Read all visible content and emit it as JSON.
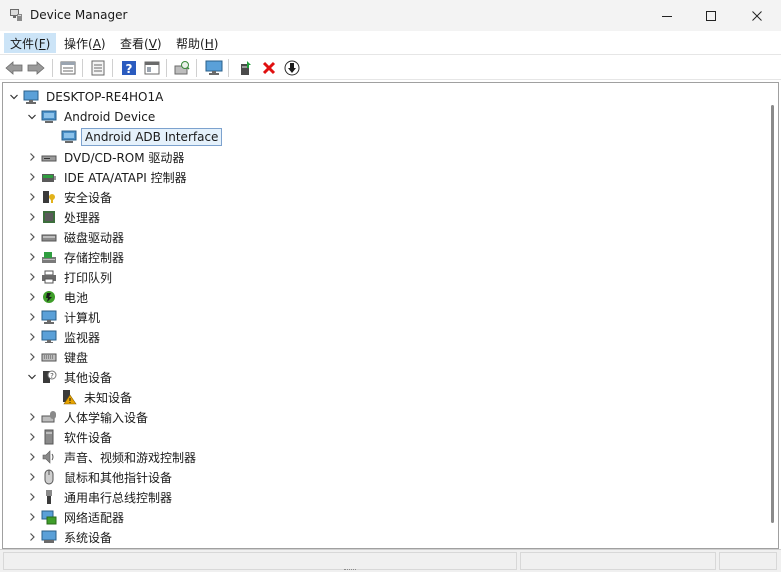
{
  "window": {
    "title": "Device Manager",
    "icon": "device-manager-icon",
    "controls": [
      "minimize-icon",
      "maximize-icon",
      "close-icon"
    ]
  },
  "menu": [
    {
      "label": "文件(",
      "key": "F",
      "suffix": ")",
      "active": true
    },
    {
      "label": "操作(",
      "key": "A",
      "suffix": ")",
      "active": false
    },
    {
      "label": "查看(",
      "key": "V",
      "suffix": ")",
      "active": false
    },
    {
      "label": "帮助(",
      "key": "H",
      "suffix": ")",
      "active": false
    }
  ],
  "toolbar": {
    "buttons": [
      "back-icon",
      "forward-icon",
      "properties-sheet-icon",
      "update-driver-list-icon",
      "help-icon",
      "view-icon",
      "scan-hardware-icon",
      "monitor-icon",
      "enable-device-icon",
      "uninstall-device-icon",
      "download-driver-icon"
    ]
  },
  "tree": {
    "root": {
      "label": "DESKTOP-RE4HO1A",
      "icon": "computer-icon",
      "expanded": true
    },
    "nodes": [
      {
        "label": "Android Device",
        "icon": "android-device-icon",
        "expanded": true,
        "level": 1
      },
      {
        "label": "Android ADB Interface",
        "icon": "adb-interface-icon",
        "level": 2,
        "selected": true
      },
      {
        "label": "DVD/CD-ROM 驱动器",
        "icon": "dvd-drive-icon",
        "expanded": false,
        "level": 1
      },
      {
        "label": "IDE ATA/ATAPI 控制器",
        "icon": "ide-controller-icon",
        "expanded": false,
        "level": 1
      },
      {
        "label": "安全设备",
        "icon": "security-device-icon",
        "expanded": false,
        "level": 1
      },
      {
        "label": "处理器",
        "icon": "processor-icon",
        "expanded": false,
        "level": 1
      },
      {
        "label": "磁盘驱动器",
        "icon": "disk-drive-icon",
        "expanded": false,
        "level": 1
      },
      {
        "label": "存储控制器",
        "icon": "storage-controller-icon",
        "expanded": false,
        "level": 1
      },
      {
        "label": "打印队列",
        "icon": "printer-icon",
        "expanded": false,
        "level": 1
      },
      {
        "label": "电池",
        "icon": "battery-icon",
        "expanded": false,
        "level": 1
      },
      {
        "label": "计算机",
        "icon": "computer-icon",
        "expanded": false,
        "level": 1
      },
      {
        "label": "监视器",
        "icon": "monitor-icon",
        "expanded": false,
        "level": 1
      },
      {
        "label": "键盘",
        "icon": "keyboard-icon",
        "expanded": false,
        "level": 1
      },
      {
        "label": "其他设备",
        "icon": "other-devices-icon",
        "expanded": true,
        "level": 1
      },
      {
        "label": "未知设备",
        "icon": "unknown-device-warning-icon",
        "level": 2
      },
      {
        "label": "人体学输入设备",
        "icon": "hid-icon",
        "expanded": false,
        "level": 1
      },
      {
        "label": "软件设备",
        "icon": "software-device-icon",
        "expanded": false,
        "level": 1
      },
      {
        "label": "声音、视频和游戏控制器",
        "icon": "sound-icon",
        "expanded": false,
        "level": 1
      },
      {
        "label": "鼠标和其他指针设备",
        "icon": "mouse-icon",
        "expanded": false,
        "level": 1
      },
      {
        "label": "通用串行总线控制器",
        "icon": "usb-icon",
        "expanded": false,
        "level": 1
      },
      {
        "label": "网络适配器",
        "icon": "network-adapter-icon",
        "expanded": false,
        "level": 1
      },
      {
        "label": "系统设备",
        "icon": "system-devices-icon",
        "expanded": false,
        "level": 1
      }
    ]
  },
  "colors": {
    "selection_bg": "#e5f1fb",
    "selection_border": "#7da2ce",
    "menu_active_bg": "#cce4f7",
    "warning": "#e8a400",
    "uninstall_red": "#e01010"
  }
}
